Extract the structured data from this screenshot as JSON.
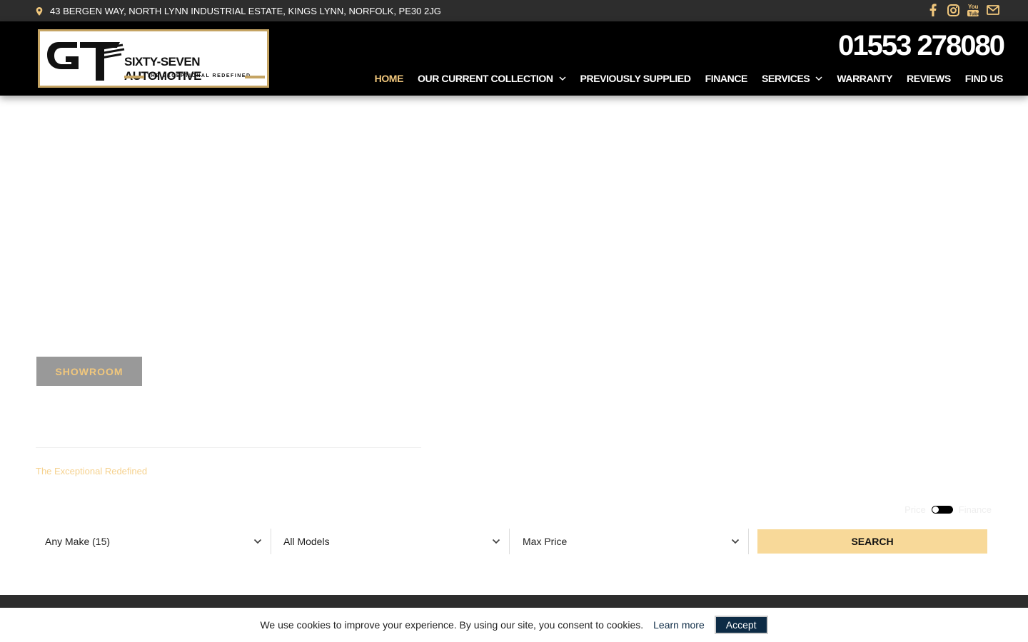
{
  "topbar": {
    "address": "43 BERGEN WAY, NORTH LYNN INDUSTRIAL ESTATE, KINGS LYNN, NORFOLK, PE30 2JG",
    "social_icons": [
      "facebook-icon",
      "instagram-icon",
      "youtube-icon",
      "envelope-icon"
    ]
  },
  "header": {
    "logo": {
      "letters": "GT",
      "brand": "SIXTY-SEVEN AUTOMOTIVE",
      "tagline": "THE EXCEPTIONAL REDEFINED"
    },
    "phone": "01553 278080",
    "nav": [
      {
        "label": "HOME",
        "active": true,
        "has_dropdown": false
      },
      {
        "label": "OUR CURRENT COLLECTION",
        "active": false,
        "has_dropdown": true
      },
      {
        "label": "PREVIOUSLY SUPPLIED",
        "active": false,
        "has_dropdown": false
      },
      {
        "label": "FINANCE",
        "active": false,
        "has_dropdown": false
      },
      {
        "label": "SERVICES",
        "active": false,
        "has_dropdown": true
      },
      {
        "label": "WARRANTY",
        "active": false,
        "has_dropdown": false
      },
      {
        "label": "REVIEWS",
        "active": false,
        "has_dropdown": false
      },
      {
        "label": "FIND US",
        "active": false,
        "has_dropdown": false
      }
    ]
  },
  "hero": {
    "showroom_label": "SHOWROOM",
    "tagline": "The Exceptional Redefined"
  },
  "search": {
    "toggle": {
      "left": "Price",
      "right": "Finance"
    },
    "make": "Any Make (15)",
    "model": "All Models",
    "price": "Max Price",
    "button": "SEARCH"
  },
  "cookie": {
    "message": "We use cookies to improve your experience. By using our site, you consent to cookies.",
    "learn_more": "Learn more",
    "accept": "Accept"
  },
  "colors": {
    "accent_gold": "#f1c77c",
    "topbar_bg": "#2d2d2d",
    "header_bg": "#000000",
    "search_button_bg": "#f8d999",
    "cookie_accept_bg": "#0d2b45"
  }
}
